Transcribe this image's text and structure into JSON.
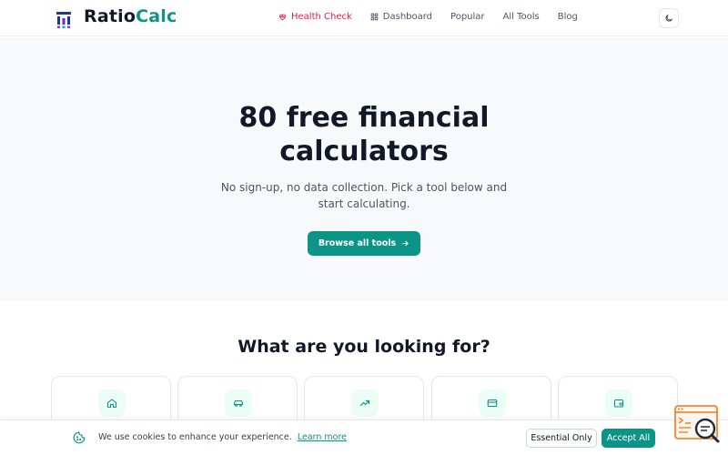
{
  "header": {
    "brand_part1": "Ratio",
    "brand_part2": "Calc",
    "nav": [
      {
        "label": "Health Check",
        "icon": "heart-icon"
      },
      {
        "label": "Dashboard",
        "icon": "grid-icon"
      },
      {
        "label": "Popular"
      },
      {
        "label": "All Tools"
      },
      {
        "label": "Blog"
      }
    ],
    "theme_toggle_icon": "moon-icon"
  },
  "hero": {
    "title_line1": "80 free financial",
    "title_line2": "calculators",
    "subtitle_line1": "No sign-up, no data collection. Pick a tool below and",
    "subtitle_line2": "start calculating.",
    "cta_label": "Browse all tools"
  },
  "section": {
    "title": "What are you looking for?",
    "cards": [
      {
        "icon": "home-icon"
      },
      {
        "icon": "car-icon"
      },
      {
        "icon": "trending-up-icon"
      },
      {
        "icon": "credit-card-icon"
      },
      {
        "icon": "wallet-icon"
      }
    ]
  },
  "cookie": {
    "text": "We use cookies to enhance your experience.",
    "link": "Learn more",
    "essential_label": "Essential Only",
    "accept_label": "Accept All"
  },
  "colors": {
    "accent": "#0d9488",
    "active_nav": "#e11d48",
    "text": "#111827",
    "hero_bg": "#f8f9fa"
  }
}
